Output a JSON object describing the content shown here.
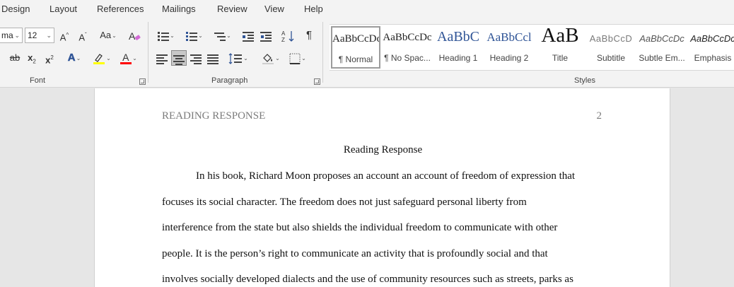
{
  "menu": {
    "tabs": [
      "Design",
      "Layout",
      "References",
      "Mailings",
      "Review",
      "View",
      "Help"
    ]
  },
  "ribbon": {
    "font": {
      "name_value": "ma",
      "size_value": "12",
      "grow_label": "A",
      "shrink_label": "A",
      "case_label": "Aa",
      "strike_label": "ab",
      "subscript_label": "x",
      "superscript_label": "x",
      "effects_label": "A",
      "font_color_label": "A",
      "group_label": "Font"
    },
    "paragraph": {
      "pilcrow_label": "¶",
      "group_label": "Paragraph"
    },
    "styles": {
      "group_label": "Styles",
      "items": [
        {
          "preview": "AaBbCcDc",
          "name": "¶ Normal"
        },
        {
          "preview": "AaBbCcDc",
          "name": "¶ No Spac..."
        },
        {
          "preview": "AaBbC",
          "name": "Heading 1"
        },
        {
          "preview": "AaBbCcl",
          "name": "Heading 2"
        },
        {
          "preview": "AaB",
          "name": "Title"
        },
        {
          "preview": "AaBbCcD",
          "name": "Subtitle"
        },
        {
          "preview": "AaBbCcDc",
          "name": "Subtle Em..."
        },
        {
          "preview": "AaBbCcDc",
          "name": "Emphasis"
        }
      ],
      "colors": {
        "heading": "#2f5496",
        "subtitle": "#7a7a7a"
      }
    },
    "colors": {
      "highlight": "#ffff00",
      "font_color": "#ff0000",
      "effects": "#2f5496"
    }
  },
  "document": {
    "running_head": "READING RESPONSE",
    "page_number": "2",
    "title": "Reading Response",
    "lines": [
      "In his book, Richard Moon proposes an account an account of freedom of expression that",
      "focuses its social character. The freedom does not just safeguard personal liberty from",
      "interference from the state but also shields the individual freedom to communicate with other",
      "people. It is the person’s right to communicate an activity that is profoundly social and that",
      "involves socially developed dialects and the use of community resources such as streets, parks as"
    ]
  }
}
